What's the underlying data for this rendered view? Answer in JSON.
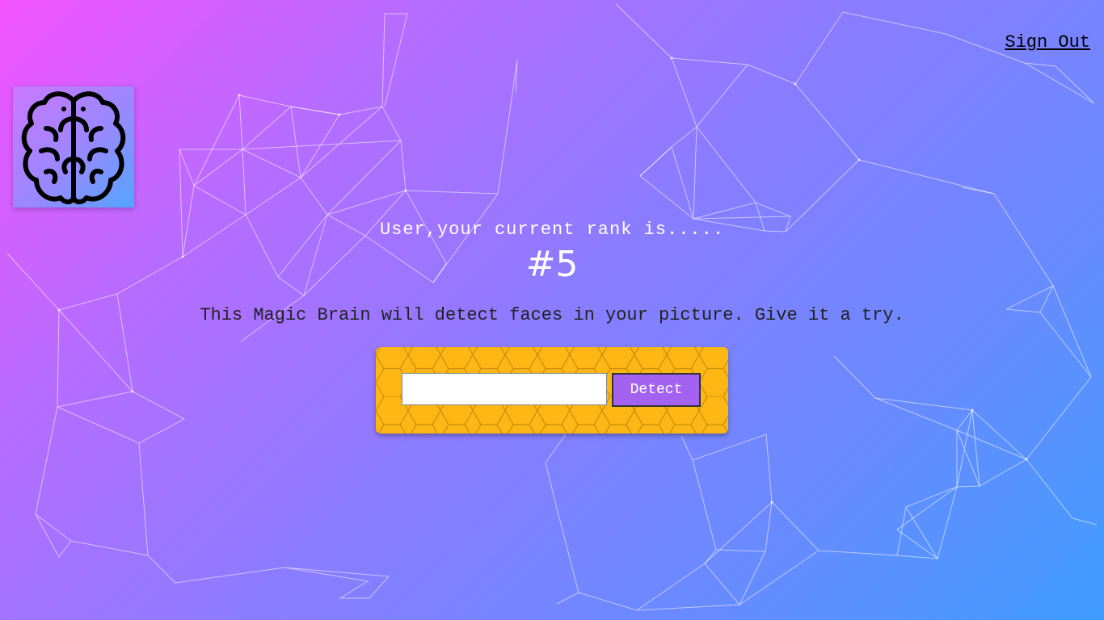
{
  "header": {
    "sign_out_label": "Sign Out"
  },
  "logo": {
    "icon": "brain-icon"
  },
  "rank": {
    "text": "User,your current rank is.....",
    "value": "#5"
  },
  "tagline": "This Magic Brain will detect faces in your picture. Give it a try.",
  "image_form": {
    "url_value": "",
    "detect_label": "Detect"
  },
  "colors": {
    "gradient_start": "#f253ff",
    "gradient_end": "#3f9dff",
    "panel": "#fcb714",
    "button": "#a363f0"
  }
}
